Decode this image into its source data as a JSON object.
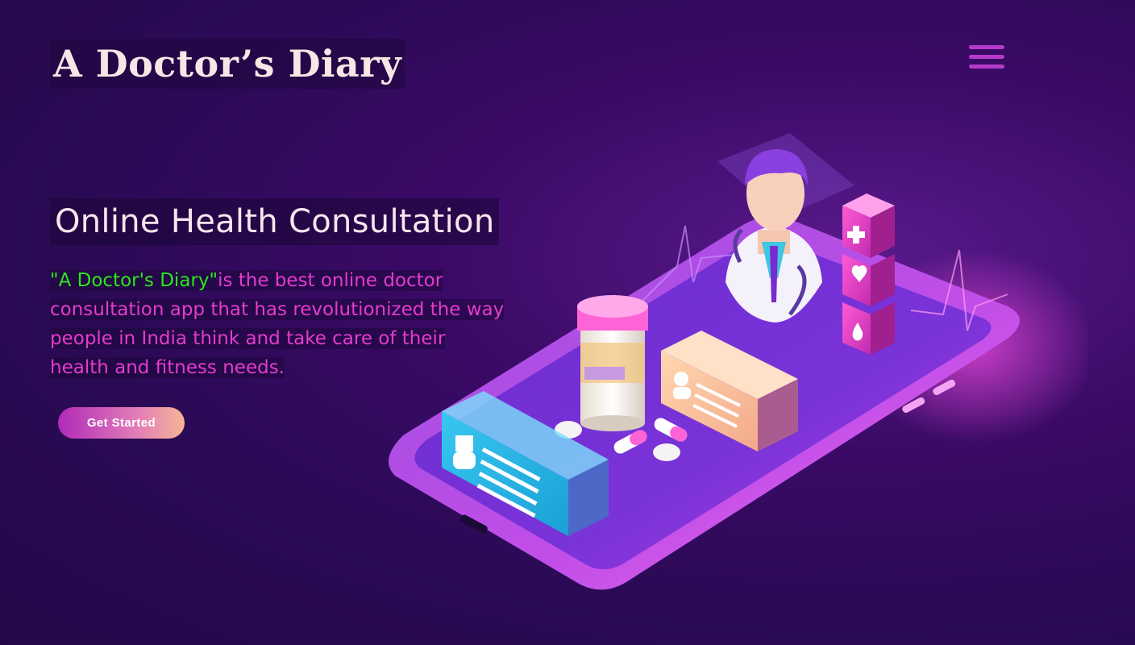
{
  "header": {
    "logo_text": "A Doctor’s Diary",
    "menu_icon": "hamburger-menu-icon"
  },
  "hero": {
    "title": "Online Health Consultation",
    "brand_quote": "\"A Doctor's Diary\"",
    "desc_line1": "is the best online doctor",
    "desc_line2": "consultation app that has revolutionized the way",
    "desc_line3": "people in India think and take care of their",
    "desc_line4": "health and fitness needs.",
    "cta_label": "Get Started"
  },
  "illustration": {
    "icons": [
      "doctor-avatar-icon",
      "plus-cross-icon",
      "heart-icon",
      "blood-drop-icon",
      "pill-bottle-icon",
      "profile-card-icon",
      "nurse-card-icon",
      "pill-capsule-icon"
    ]
  },
  "colors": {
    "background": "#2a0a55",
    "logo": "#f7e6e6",
    "headline": "#f6e6ec",
    "description": "#e43ccd",
    "brand_highlight": "#2ee61e",
    "menu": "#b43bc8",
    "cta_gradient_start": "#b12ab8",
    "cta_gradient_end": "#f7b595"
  }
}
